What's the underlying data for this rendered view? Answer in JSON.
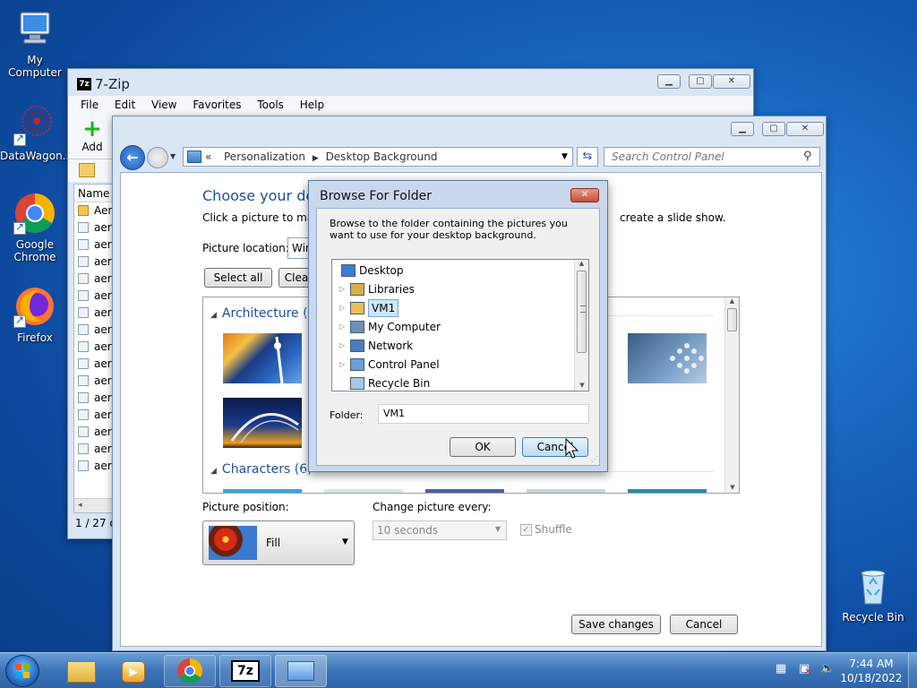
{
  "desktop": {
    "icons": [
      {
        "label": "My Computer"
      },
      {
        "label": "DataWagon..."
      },
      {
        "label": "Google Chrome"
      },
      {
        "label": "Firefox"
      },
      {
        "label": "Recycle Bin"
      }
    ]
  },
  "zip_window": {
    "title": "7-Zip",
    "menu": [
      "File",
      "Edit",
      "View",
      "Favorites",
      "Tools",
      "Help"
    ],
    "add_label": "Add",
    "column_name": "Name",
    "files": [
      "Aer",
      "aer",
      "aer",
      "aer",
      "aer",
      "aer",
      "aer",
      "aer",
      "aer",
      "aer",
      "aer",
      "aer",
      "aer",
      "aer",
      "aer",
      "aer"
    ],
    "status": "1 / 27 o"
  },
  "cp_window": {
    "breadcrumb_prefix": "«",
    "breadcrumb": [
      "Personalization",
      "Desktop Background"
    ],
    "search_placeholder": "Search Control Panel",
    "heading": "Choose your desk",
    "instructions_left": "Click a picture to make",
    "instructions_right": "create a slide show.",
    "picture_location_label": "Picture location:",
    "picture_location_value": "Win",
    "select_all": "Select all",
    "clear_all": "Clea",
    "group1": "Architecture (6",
    "group2": "Characters (6)",
    "picture_position_label": "Picture position:",
    "picture_position_value": "Fill",
    "change_every_label": "Change picture every:",
    "change_every_value": "10 seconds",
    "shuffle_label": "Shuffle",
    "save_label": "Save changes",
    "cancel_label": "Cancel"
  },
  "dialog": {
    "title": "Browse For Folder",
    "description": "Browse to the folder containing the pictures you want to use for your desktop background.",
    "tree": [
      {
        "label": "Desktop",
        "expandable": false
      },
      {
        "label": "Libraries",
        "expandable": true
      },
      {
        "label": "VM1",
        "expandable": true
      },
      {
        "label": "My Computer",
        "expandable": true
      },
      {
        "label": "Network",
        "expandable": true
      },
      {
        "label": "Control Panel",
        "expandable": true
      },
      {
        "label": "Recycle Bin",
        "expandable": false
      }
    ],
    "folder_label": "Folder:",
    "folder_value": "VM1",
    "ok_label": "OK",
    "cancel_label": "Cancel"
  },
  "taskbar": {
    "time": "7:44 AM",
    "date": "10/18/2022"
  },
  "colors": {
    "link_blue": "#1f4e9a",
    "dialog_selection": "#cce8ff"
  }
}
